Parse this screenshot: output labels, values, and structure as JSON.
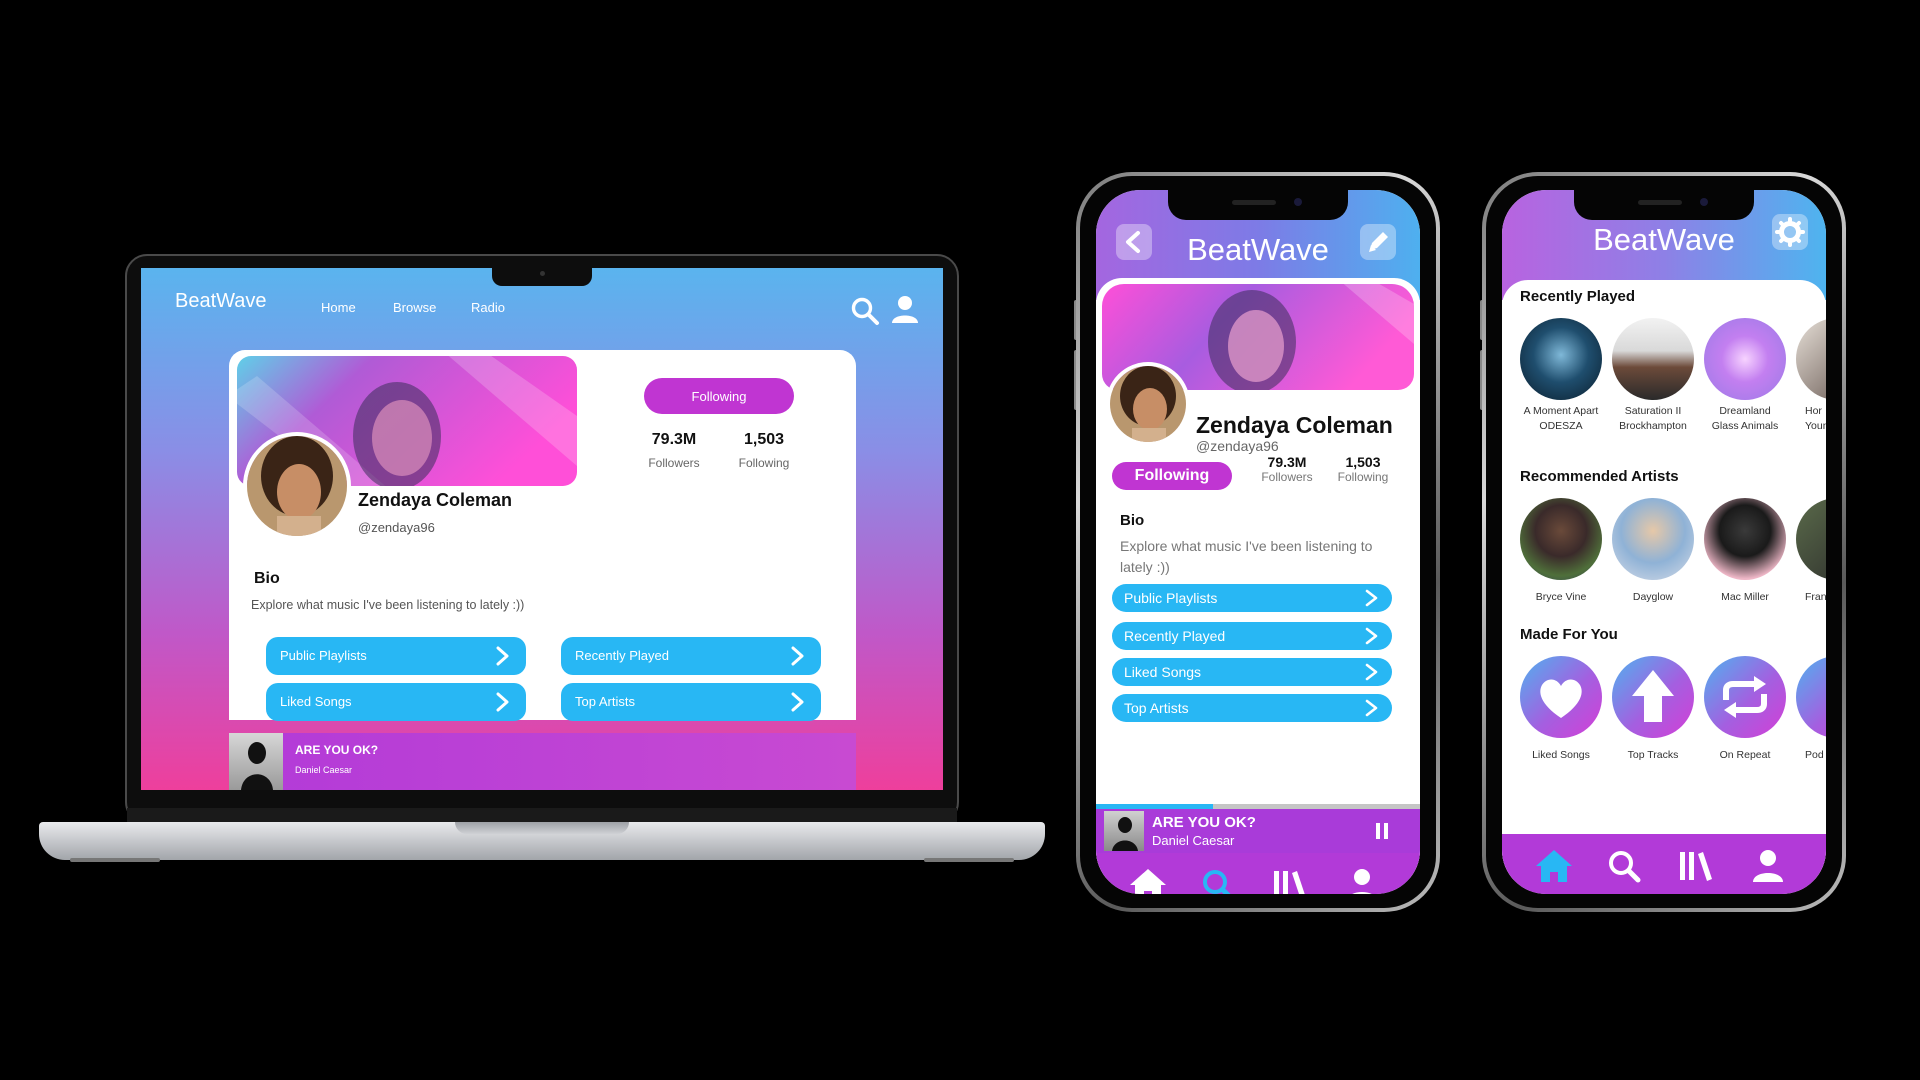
{
  "brand": "BeatWave",
  "desktop": {
    "nav": [
      "Home",
      "Browse",
      "Radio"
    ],
    "profile": {
      "name": "Zendaya Coleman",
      "handle": "@zendaya96",
      "follow_label": "Following",
      "followers_count": "79.3M",
      "followers_label": "Followers",
      "following_count": "1,503",
      "following_label": "Following",
      "bio_heading": "Bio",
      "bio_text": "Explore what music I've been listening to lately :))"
    },
    "buttons": [
      "Public Playlists",
      "Recently Played",
      "Liked Songs",
      "Top Artists"
    ],
    "now_playing": {
      "title": "ARE YOU OK?",
      "artist": "Daniel Caesar"
    }
  },
  "phone_profile": {
    "name": "Zendaya Coleman",
    "handle": "@zendaya96",
    "follow_label": "Following",
    "followers_count": "79.3M",
    "followers_label": "Followers",
    "following_count": "1,503",
    "following_label": "Following",
    "bio_heading": "Bio",
    "bio_text": "Explore what music I've been listening to lately :))",
    "buttons": [
      "Public Playlists",
      "Recently Played",
      "Liked Songs",
      "Top Artists"
    ],
    "now_playing": {
      "title": "ARE YOU OK?",
      "artist": "Daniel Caesar",
      "progress": 0.36
    },
    "active_tab": "search"
  },
  "phone_home": {
    "recently_played_heading": "Recently Played",
    "recently_played": [
      {
        "title": "A Moment Apart",
        "artist": "ODESZA"
      },
      {
        "title": "Saturation II",
        "artist": "Brockhampton"
      },
      {
        "title": "Dreamland",
        "artist": "Glass Animals"
      },
      {
        "title": "Hor",
        "artist": "Young"
      }
    ],
    "recommended_heading": "Recommended Artists",
    "recommended_artists": [
      "Bryce Vine",
      "Dayglow",
      "Mac Miller",
      "Fran"
    ],
    "made_for_you_heading": "Made For You",
    "made_for_you": [
      "Liked Songs",
      "Top Tracks",
      "On Repeat",
      "Pod"
    ],
    "active_tab": "home"
  },
  "colors": {
    "accent_purple": "#c035d2",
    "button_blue": "#28b7f4",
    "active_tab_blue": "#28b7f4"
  }
}
